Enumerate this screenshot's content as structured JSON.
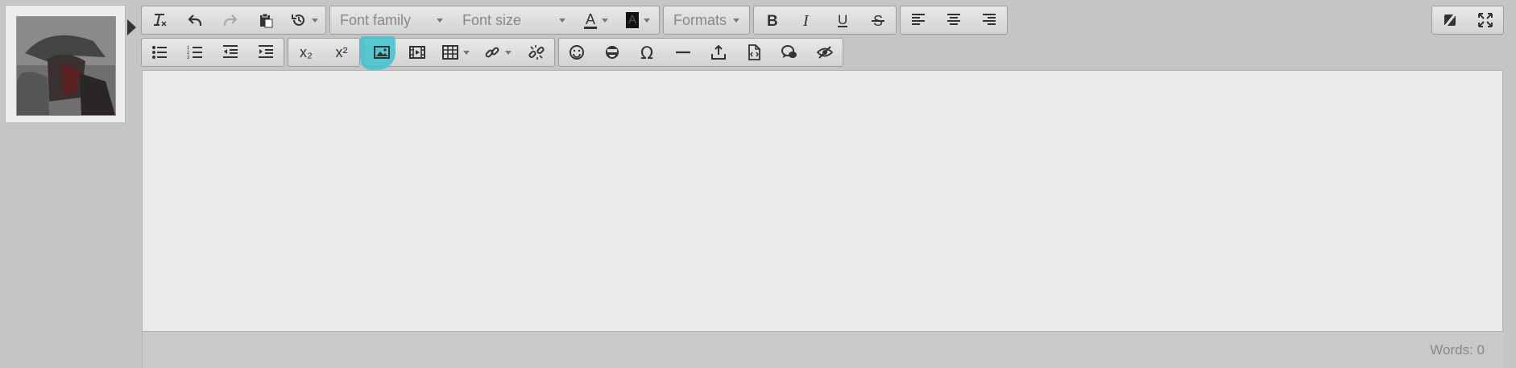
{
  "toolbar": {
    "font_family_placeholder": "Font family",
    "font_size_placeholder": "Font size",
    "formats_label": "Formats",
    "subscript_label": "x₂",
    "superscript_label": "x²",
    "text_color_letter": "A",
    "bg_color_letter": "A"
  },
  "statusbar": {
    "word_count": "Words: 0"
  },
  "colors": {
    "highlight": "#3ec3cf",
    "toolbar_bg": "#d9d9d9",
    "content_bg": "#e9ebe9"
  }
}
